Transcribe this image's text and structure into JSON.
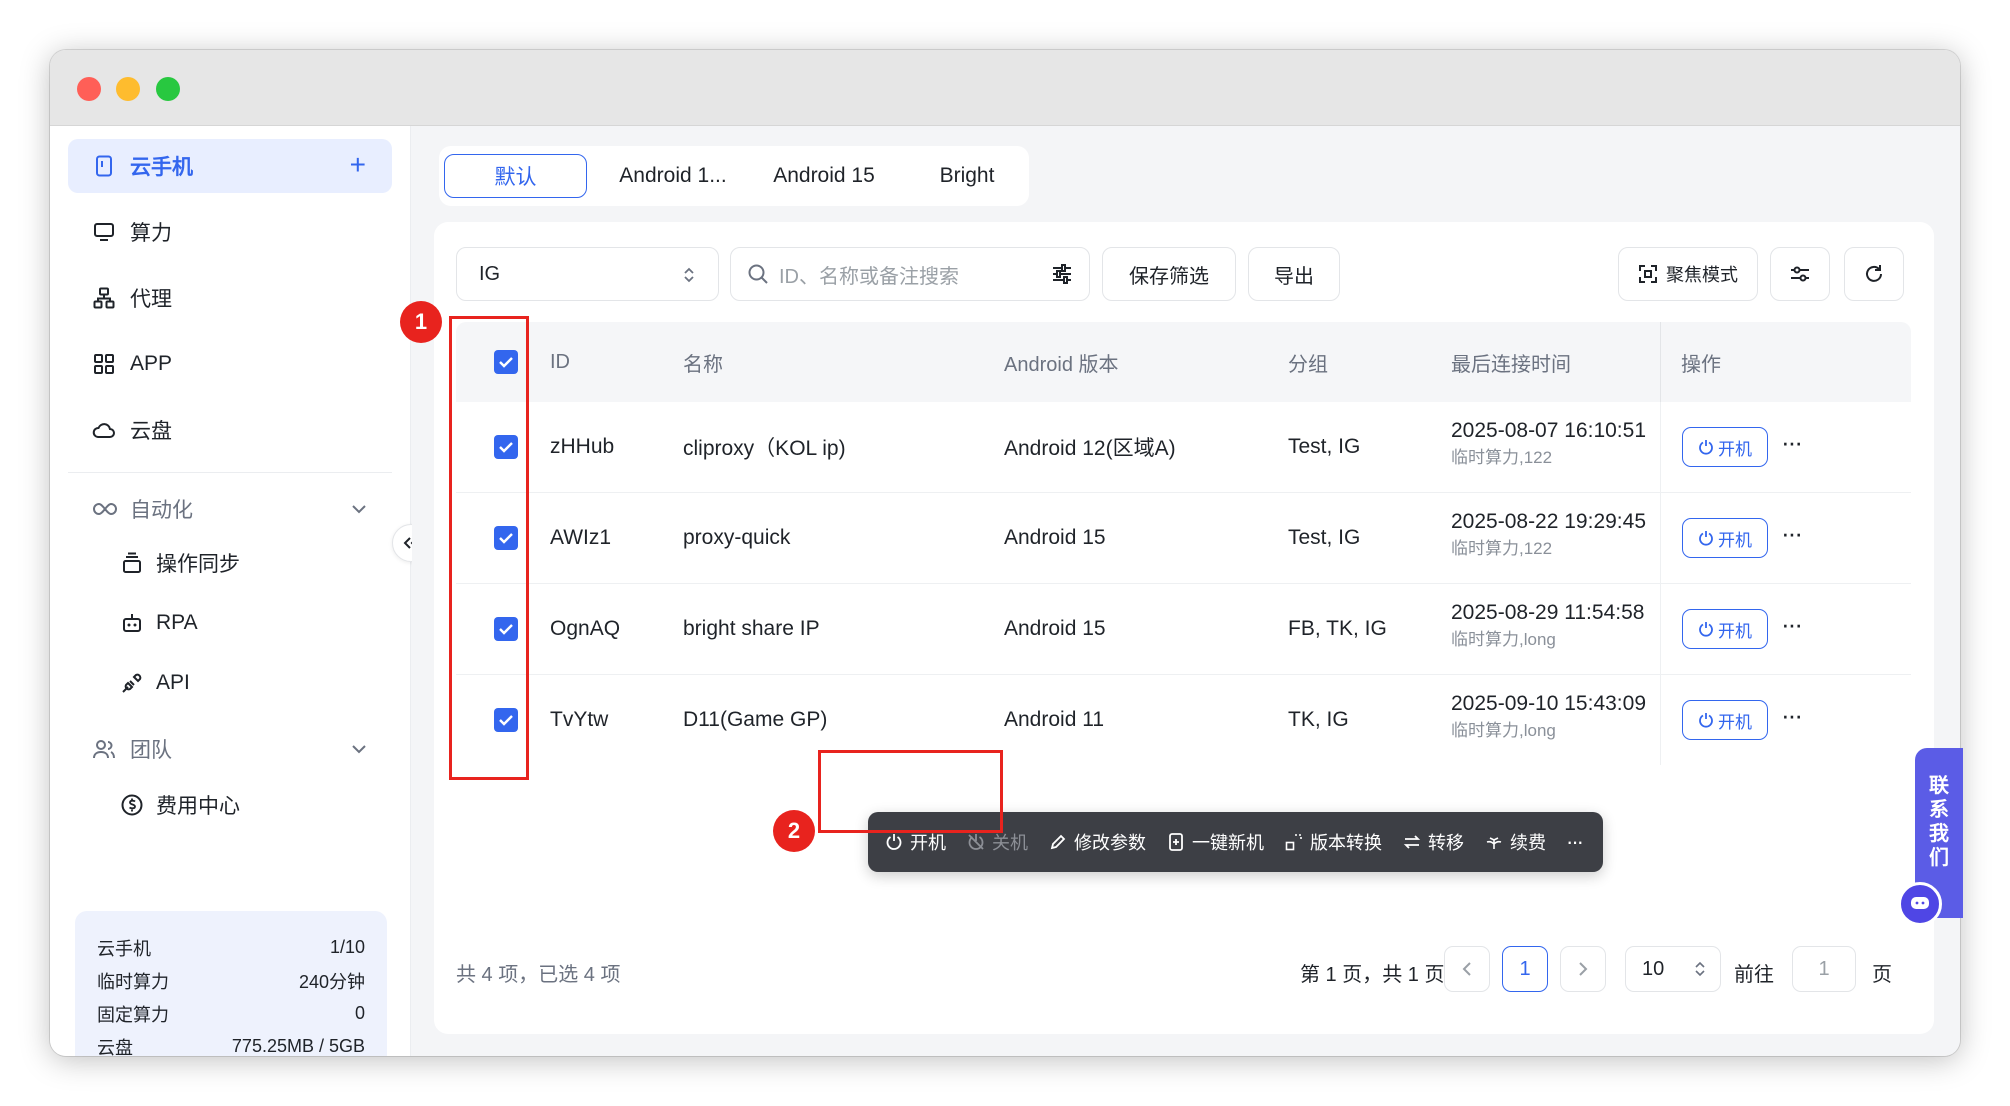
{
  "sidebar": {
    "items": [
      {
        "label": "云手机",
        "icon": "phone-icon",
        "active": true
      },
      {
        "label": "算力",
        "icon": "monitor-icon"
      },
      {
        "label": "代理",
        "icon": "network-icon"
      },
      {
        "label": "APP",
        "icon": "apps-grid-icon"
      },
      {
        "label": "云盘",
        "icon": "cloud-icon"
      }
    ],
    "automation": {
      "label": "自动化",
      "children": [
        {
          "label": "操作同步",
          "icon": "sync-icon"
        },
        {
          "label": "RPA",
          "icon": "robot-icon"
        },
        {
          "label": "API",
          "icon": "plug-icon"
        }
      ]
    },
    "team": {
      "label": "团队",
      "children": [
        {
          "label": "费用中心",
          "icon": "dollar-icon"
        }
      ]
    },
    "usage": [
      {
        "label": "云手机",
        "value": "1/10"
      },
      {
        "label": "临时算力",
        "value": "240分钟"
      },
      {
        "label": "固定算力",
        "value": "0"
      },
      {
        "label": "云盘",
        "value": "775.25MB / 5GB"
      }
    ]
  },
  "tabs": [
    {
      "label": "默认",
      "active": true
    },
    {
      "label": "Android 1..."
    },
    {
      "label": "Android 15"
    },
    {
      "label": "Bright"
    }
  ],
  "filters": {
    "group_select": "IG",
    "search_placeholder": "ID、名称或备注搜索",
    "save_filter": "保存筛选",
    "export": "导出",
    "focus_mode": "聚焦模式"
  },
  "table": {
    "columns": [
      "ID",
      "名称",
      "Android 版本",
      "分组",
      "最后连接时间",
      "操作"
    ],
    "rows": [
      {
        "id": "zHHub",
        "name": "cliproxy（KOL ip)",
        "android": "Android 12(区域A)",
        "group": "Test, IG",
        "time": "2025-08-07 16:10:51",
        "sub": "临时算力,122",
        "action": "开机"
      },
      {
        "id": "AWIz1",
        "name": "proxy-quick",
        "android": "Android 15",
        "group": "Test, IG",
        "time": "2025-08-22 19:29:45",
        "sub": "临时算力,122",
        "action": "开机"
      },
      {
        "id": "OgnAQ",
        "name": "bright share IP",
        "android": "Android 15",
        "group": "FB, TK, IG",
        "time": "2025-08-29 11:54:58",
        "sub": "临时算力,long",
        "action": "开机"
      },
      {
        "id": "TvYtw",
        "name": "D11(Game GP)",
        "android": "Android 11",
        "group": "TK, IG",
        "time": "2025-09-10 15:43:09",
        "sub": "临时算力,long",
        "action": "开机"
      }
    ]
  },
  "bulk_toolbar": {
    "power_on": "开机",
    "power_off": "关机",
    "modify_params": "修改参数",
    "new_device": "一键新机",
    "version_convert": "版本转换",
    "transfer": "转移",
    "renew": "续费",
    "more": "···"
  },
  "annotations": {
    "one": "1",
    "two": "2"
  },
  "footer": {
    "summary": "共 4 项，已选 4 项",
    "page_info": "第 1 页，共 1 页",
    "current_page": "1",
    "page_size": "10",
    "goto_label": "前往",
    "goto_value": "1",
    "page_suffix": "页"
  },
  "contact": {
    "label": [
      "联",
      "系",
      "我",
      "们"
    ]
  },
  "colors": {
    "accent": "#3366ee",
    "annotation": "#e8231e",
    "toolbar": "#3d3f45",
    "contact": "#5b5ce6"
  }
}
